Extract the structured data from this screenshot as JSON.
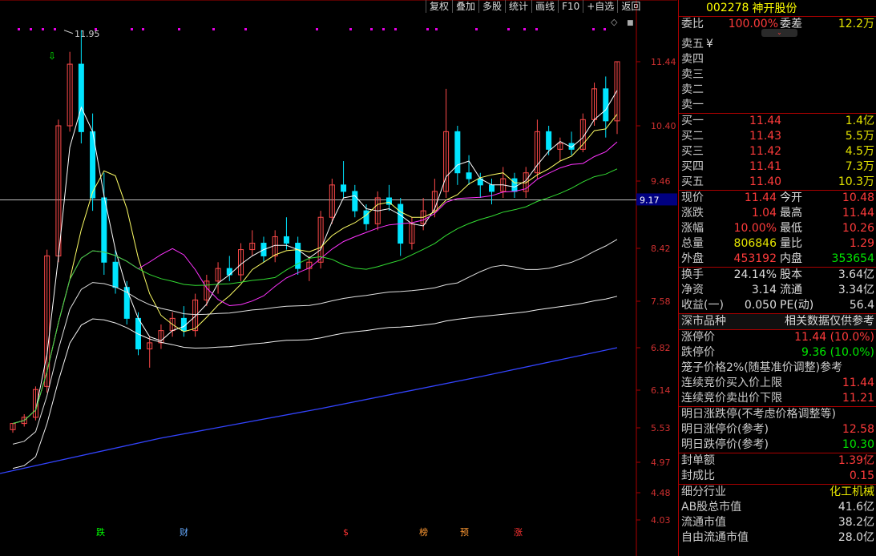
{
  "toolbar": [
    "复权",
    "叠加",
    "多股",
    "统计",
    "画线",
    "F10",
    "+自选",
    "返回"
  ],
  "chart": {
    "price_axis": [
      "11.44",
      "10.40",
      "9.46",
      "8.42",
      "7.58",
      "6.82",
      "6.14",
      "5.53",
      "4.97",
      "4.48",
      "4.03"
    ],
    "current_price_label": "9.17",
    "peak_label": "11.95",
    "event_markers": [
      {
        "text": "跌",
        "color": "#00ff00"
      },
      {
        "text": "财",
        "color": "#66aaff"
      },
      {
        "text": "$",
        "color": "#ff3333"
      },
      {
        "text": "榜",
        "color": "#ff9933"
      },
      {
        "text": "预",
        "color": "#ff9933"
      },
      {
        "text": "涨",
        "color": "#ff3333"
      }
    ]
  },
  "chart_data": {
    "type": "candlestick",
    "price_ticks": [
      11.44,
      10.4,
      9.46,
      8.42,
      7.58,
      6.82,
      6.14,
      5.53,
      4.97,
      4.48,
      4.03
    ],
    "current_price": 9.17,
    "peak_annotation": 11.95,
    "last_close": 11.44,
    "grid": false
  },
  "header": {
    "code": "002278",
    "name": "神开股份"
  },
  "weibi": {
    "label": "委比",
    "value": "100.00%",
    "label2": "委差",
    "value2": "12.2万"
  },
  "sell_rows": [
    {
      "label": "卖五",
      "price": "",
      "vol": "",
      "extra": "¥"
    },
    {
      "label": "卖四",
      "price": "",
      "vol": ""
    },
    {
      "label": "卖三",
      "price": "",
      "vol": ""
    },
    {
      "label": "卖二",
      "price": "",
      "vol": ""
    },
    {
      "label": "卖一",
      "price": "",
      "vol": ""
    }
  ],
  "buy_rows": [
    {
      "label": "买一",
      "price": "11.44",
      "vol": "1.4亿"
    },
    {
      "label": "买二",
      "price": "11.43",
      "vol": "5.5万"
    },
    {
      "label": "买三",
      "price": "11.42",
      "vol": "4.5万"
    },
    {
      "label": "买四",
      "price": "11.41",
      "vol": "7.3万"
    },
    {
      "label": "买五",
      "price": "11.40",
      "vol": "10.3万"
    }
  ],
  "stats": [
    {
      "l1": "现价",
      "v1": "11.44",
      "c1": "red",
      "l2": "今开",
      "v2": "10.48",
      "c2": "red"
    },
    {
      "l1": "涨跌",
      "v1": "1.04",
      "c1": "red",
      "l2": "最高",
      "v2": "11.44",
      "c2": "red"
    },
    {
      "l1": "涨幅",
      "v1": "10.00%",
      "c1": "red",
      "l2": "最低",
      "v2": "10.26",
      "c2": "red"
    },
    {
      "l1": "总量",
      "v1": "806846",
      "c1": "yel",
      "l2": "量比",
      "v2": "1.29",
      "c2": "red"
    },
    {
      "l1": "外盘",
      "v1": "453192",
      "c1": "red",
      "l2": "内盘",
      "v2": "353654",
      "c2": "green"
    }
  ],
  "stats2": [
    {
      "l1": "换手",
      "v1": "24.14%",
      "l2": "股本",
      "v2": "3.64亿"
    },
    {
      "l1": "净资",
      "v1": "3.14",
      "l2": "流通",
      "v2": "3.34亿"
    },
    {
      "l1": "收益(一)",
      "v1": "0.050",
      "l2": "PE(动)",
      "v2": "56.4"
    }
  ],
  "market": {
    "label": "深市品种",
    "note": "相关数据仅供参考"
  },
  "limits": [
    {
      "label": "涨停价",
      "value": "11.44 (10.0%)",
      "c": "red"
    },
    {
      "label": "跌停价",
      "value": "9.36 (10.0%)",
      "c": "green"
    }
  ],
  "cage_title": "笼子价格2%(随基准价调整)参考",
  "cage": [
    {
      "label": "连续竞价买入价上限",
      "value": "11.44",
      "c": "red"
    },
    {
      "label": "连续竞价卖出价下限",
      "value": "11.21",
      "c": "red"
    }
  ],
  "tomorrow_title": "明日涨跌停(不考虑价格调整等)",
  "tomorrow": [
    {
      "label": "明日涨停价(参考)",
      "value": "12.58",
      "c": "red"
    },
    {
      "label": "明日跌停价(参考)",
      "value": "10.30",
      "c": "green"
    }
  ],
  "seal": [
    {
      "label": "封单额",
      "value": "1.39亿",
      "c": "red"
    },
    {
      "label": "封成比",
      "value": "0.15",
      "c": "red"
    }
  ],
  "industry": {
    "label": "细分行业",
    "value": "化工机械"
  },
  "caps": [
    {
      "label": "AB股总市值",
      "value": "41.6亿"
    },
    {
      "label": "流通市值",
      "value": "38.2亿"
    },
    {
      "label": "自由流通市值",
      "value": "28.0亿"
    }
  ]
}
